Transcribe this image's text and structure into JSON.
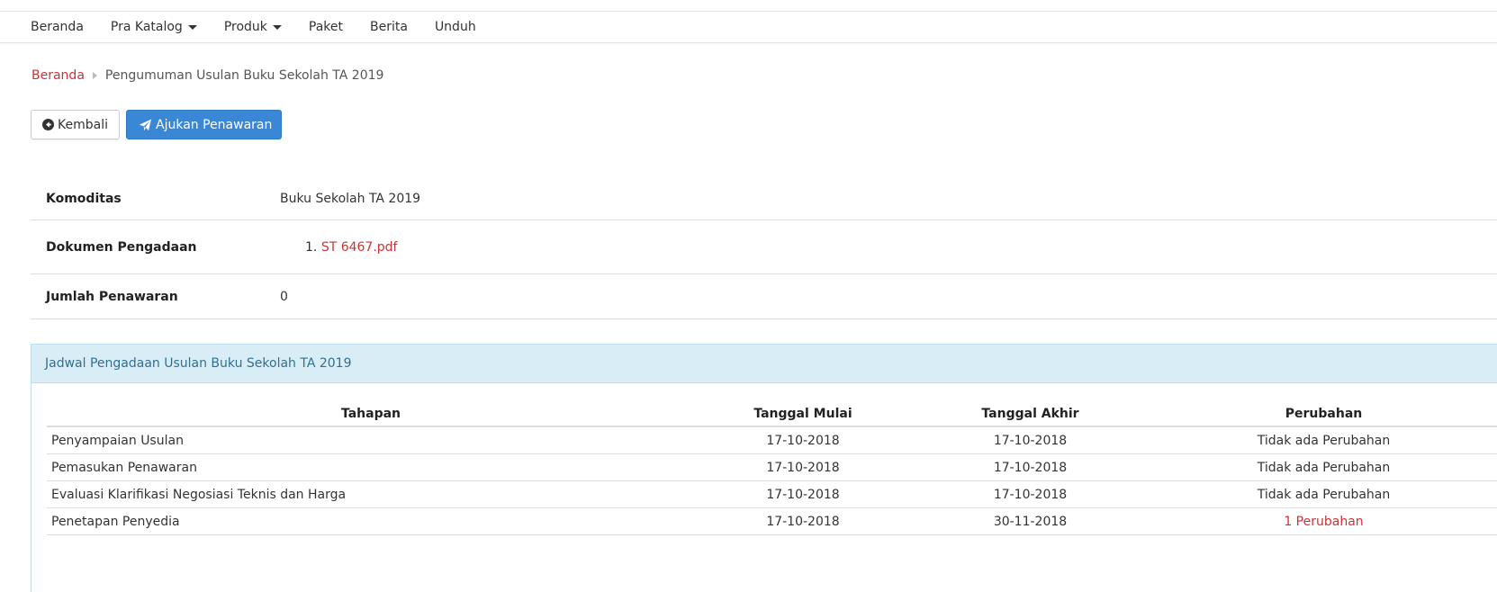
{
  "nav": {
    "items": [
      {
        "label": "Beranda"
      },
      {
        "label": "Pra Katalog"
      },
      {
        "label": "Produk"
      },
      {
        "label": "Paket"
      },
      {
        "label": "Berita"
      },
      {
        "label": "Unduh"
      }
    ]
  },
  "breadcrumb": {
    "home": "Beranda",
    "current": "Pengumuman Usulan Buku Sekolah TA 2019"
  },
  "buttons": {
    "back": "Kembali",
    "offer": "Ajukan Penawaran"
  },
  "info": {
    "komoditas_label": "Komoditas",
    "komoditas_value": "Buku Sekolah TA 2019",
    "dokumen_label": "Dokumen Pengadaan",
    "dokumen_index": "1.",
    "dokumen_file": "ST 6467.pdf",
    "jumlah_label": "Jumlah Penawaran",
    "jumlah_value": "0"
  },
  "schedule": {
    "title": "Jadwal Pengadaan Usulan Buku Sekolah TA 2019",
    "headers": [
      "Tahapan",
      "Tanggal Mulai",
      "Tanggal Akhir",
      "Perubahan"
    ],
    "rows": [
      {
        "tahapan": "Penyampaian Usulan",
        "mulai": "17-10-2018",
        "akhir": "17-10-2018",
        "perubahan": "Tidak ada Perubahan"
      },
      {
        "tahapan": "Pemasukan Penawaran",
        "mulai": "17-10-2018",
        "akhir": "17-10-2018",
        "perubahan": "Tidak ada Perubahan"
      },
      {
        "tahapan": "Evaluasi Klarifikasi Negosiasi Teknis dan Harga",
        "mulai": "17-10-2018",
        "akhir": "17-10-2018",
        "perubahan": "Tidak ada Perubahan"
      },
      {
        "tahapan": "Penetapan Penyedia",
        "mulai": "17-10-2018",
        "akhir": "30-11-2018",
        "perubahan": "1 Perubahan"
      }
    ]
  },
  "colors": {
    "link_red": "#cc3333",
    "primary_blue": "#3a87d6",
    "panel_bg": "#d9edf7",
    "panel_text": "#31708f"
  }
}
